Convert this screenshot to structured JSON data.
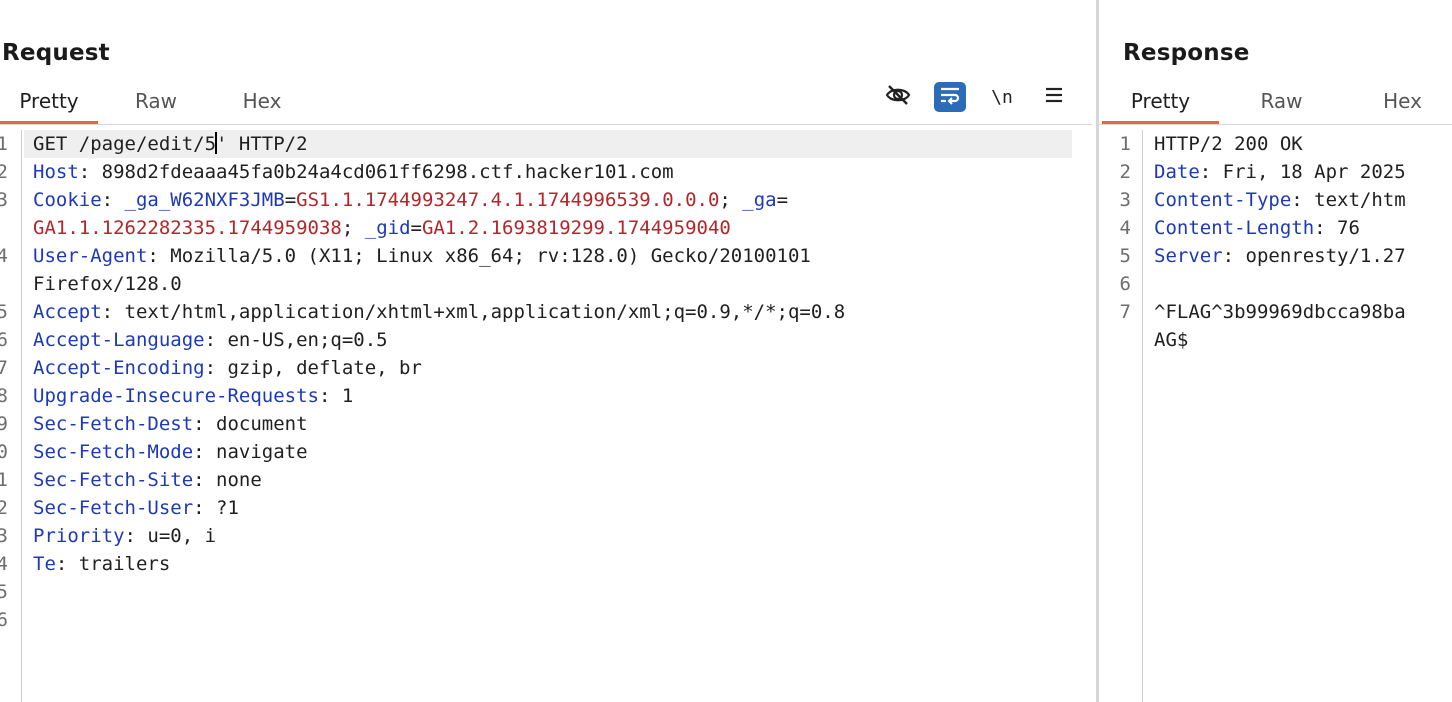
{
  "request": {
    "title": "Request",
    "tabs": [
      "Pretty",
      "Raw",
      "Hex"
    ],
    "active_tab": "Pretty",
    "toolbar": {
      "hide_icon": "eye-slash-icon",
      "wrap_icon": "word-wrap-icon",
      "newline_label": "\\n",
      "menu_icon": "hamburger-menu-icon"
    },
    "line_numbers": [
      "1",
      "2",
      "3",
      "",
      "4",
      "",
      "5",
      "6",
      "7",
      "8",
      "9",
      "0",
      "1",
      "2",
      "3",
      "4",
      "5",
      "6"
    ],
    "lines": {
      "l1_a": "GET /page/edit/5",
      "l1_b": "' HTTP/2",
      "l2_name": "Host",
      "l2_value": ": 898d2fdeaaa45fa0b24a4cd061ff6298.ctf.hacker101.com",
      "l3_name": "Cookie",
      "l3_sep": ": ",
      "l3_c1_name": "_ga_W62NXF3JMB",
      "l3_c1_val": "GS1.1.1744993247.4.1.1744996539.0.0.0",
      "l3_c2_name": "_ga",
      "l3_c2_val": "GA1.1.1262282335.1744959038",
      "l3_c3_name": "_gid",
      "l3_c3_val": "GA1.2.1693819299.1744959040",
      "l4_name": "User-Agent",
      "l4_value": ": Mozilla/5.0 (X11; Linux x86_64; rv:128.0) Gecko/20100101",
      "l4_cont": "Firefox/128.0",
      "l5_name": "Accept",
      "l5_value": ": text/html,application/xhtml+xml,application/xml;q=0.9,*/*;q=0.8",
      "l6_name": "Accept-Language",
      "l6_value": ": en-US,en;q=0.5",
      "l7_name": "Accept-Encoding",
      "l7_value": ": gzip, deflate, br",
      "l8_name": "Upgrade-Insecure-Requests",
      "l8_value": ": 1",
      "l9_name": "Sec-Fetch-Dest",
      "l9_value": ": document",
      "l10_name": "Sec-Fetch-Mode",
      "l10_value": ": navigate",
      "l11_name": "Sec-Fetch-Site",
      "l11_value": ": none",
      "l12_name": "Sec-Fetch-User",
      "l12_value": ": ?1",
      "l13_name": "Priority",
      "l13_value": ": u=0, i",
      "l14_name": "Te",
      "l14_value": ": trailers"
    }
  },
  "response": {
    "title": "Response",
    "tabs": [
      "Pretty",
      "Raw",
      "Hex"
    ],
    "active_tab": "Pretty",
    "line_numbers": [
      "1",
      "2",
      "3",
      "4",
      "5",
      "6",
      "7",
      ""
    ],
    "lines": {
      "l1": "HTTP/2 200 OK",
      "l2_name": "Date",
      "l2_value": ": Fri, 18 Apr 2025",
      "l3_name": "Content-Type",
      "l3_value": ": text/htm",
      "l4_name": "Content-Length",
      "l4_value": ": 76",
      "l5_name": "Server",
      "l5_value": ": openresty/1.27",
      "l7": "^FLAG^3b99969dbcca98ba",
      "l7_cont": "AG$"
    }
  },
  "colors": {
    "header_name": "#1d39b5",
    "cookie_value": "#b3262b",
    "active_tab_underline": "#e8673a",
    "active_tool": "#2b6cb8"
  }
}
